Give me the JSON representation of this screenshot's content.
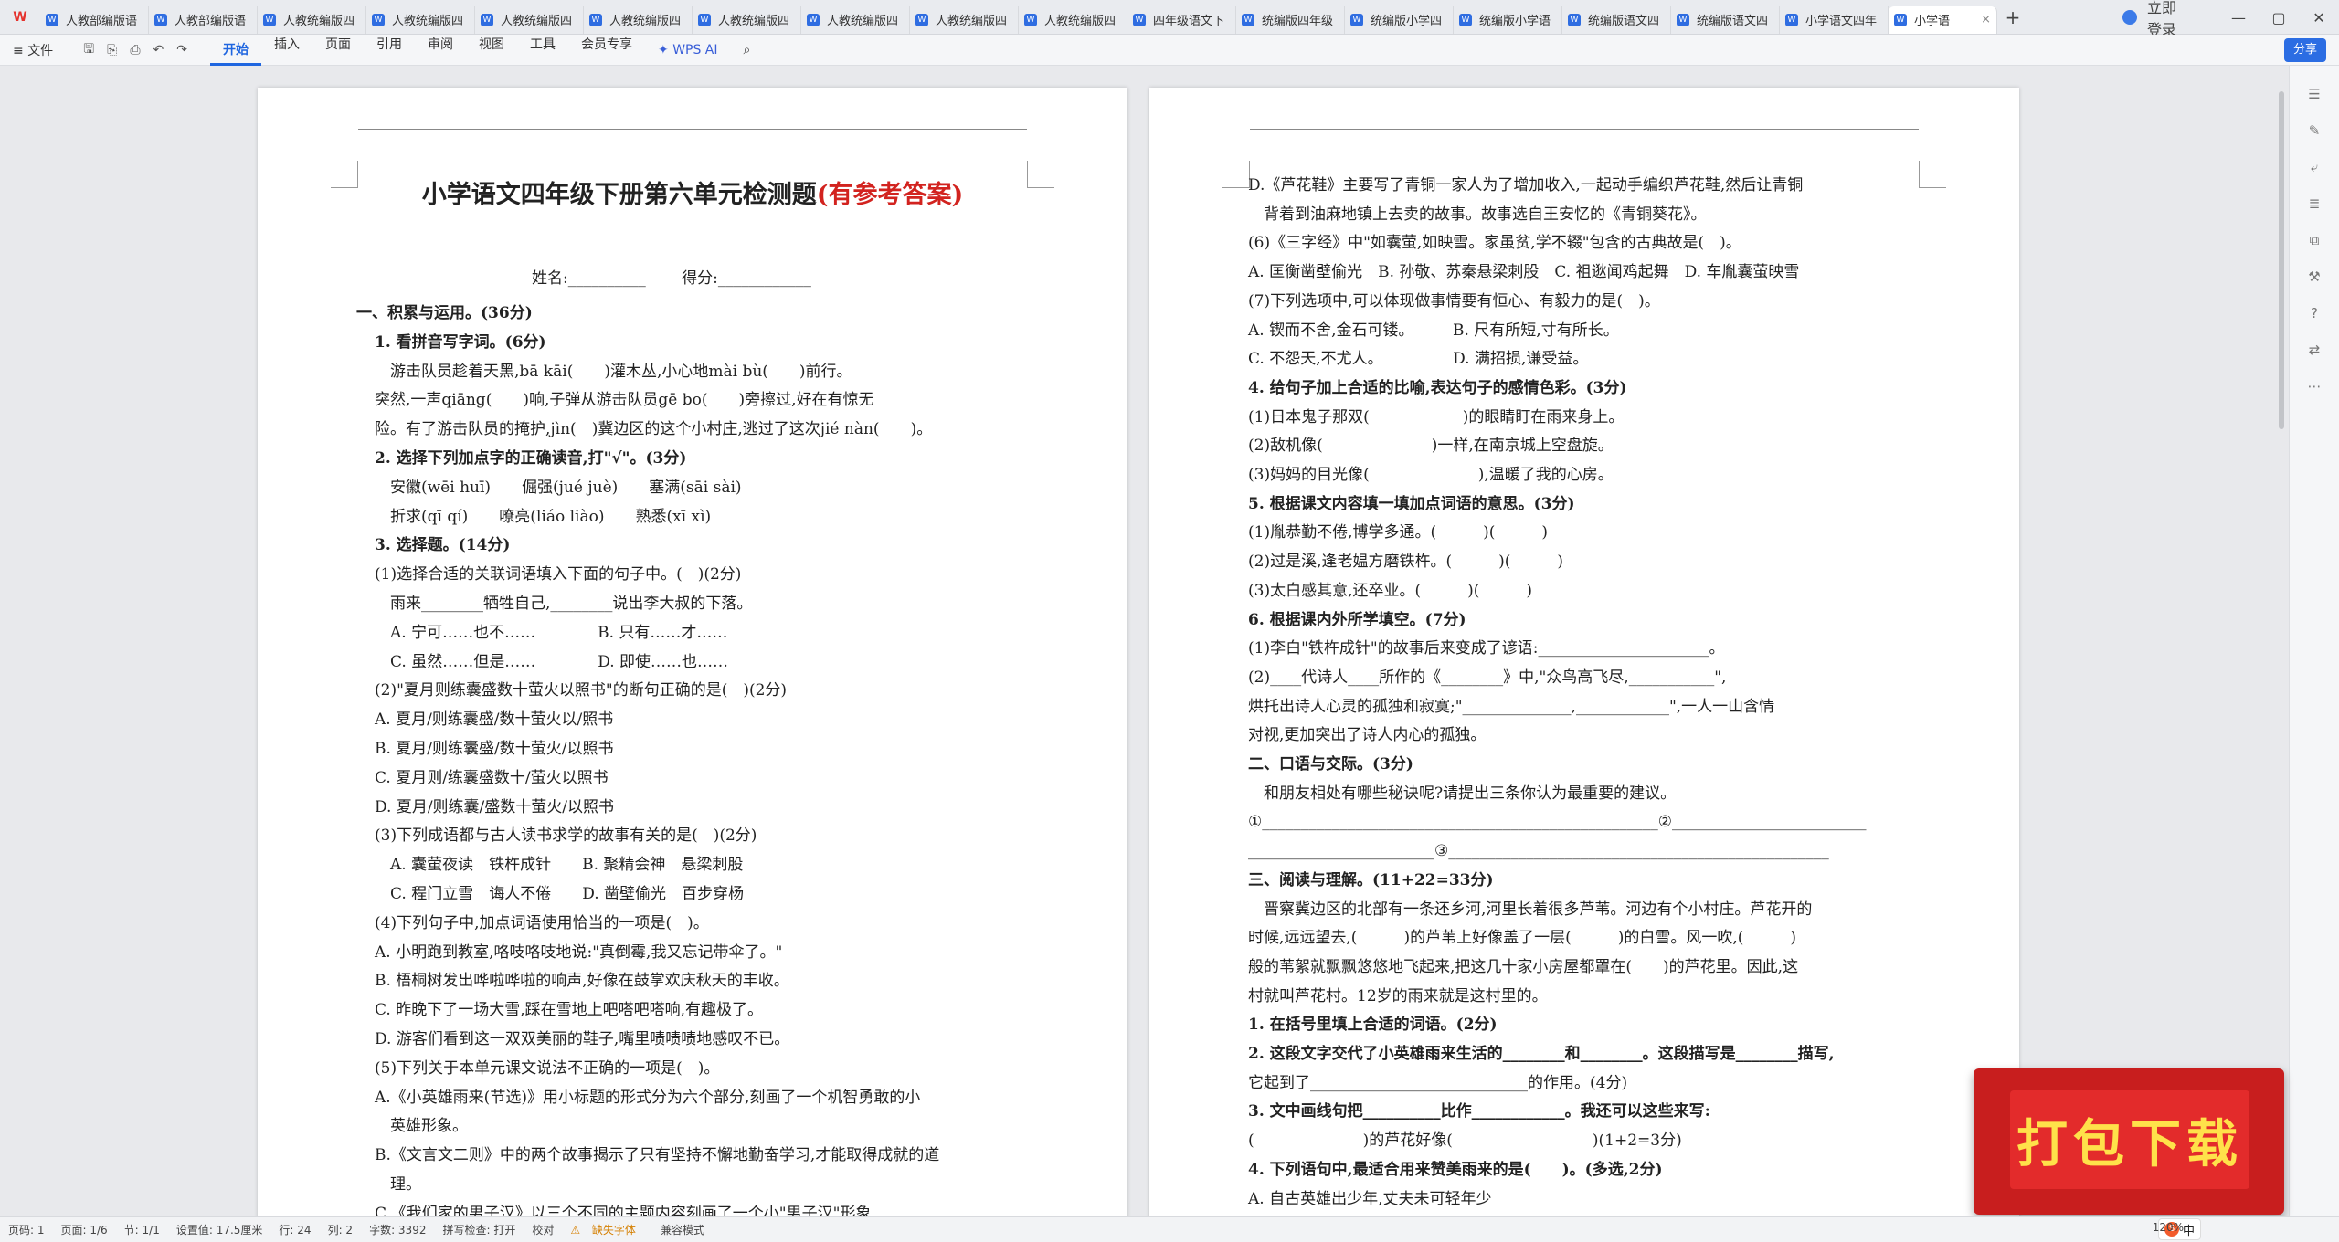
{
  "tabs": [
    "人教部编版语",
    "人教部编版语",
    "人教统编版四",
    "人教统编版四",
    "人教统编版四",
    "人教统编版四",
    "人教统编版四",
    "人教统编版四",
    "人教统编版四",
    "人教统编版四",
    "四年级语文下",
    "统编版四年级",
    "统编版小学四",
    "统编版小学语",
    "统编版语文四",
    "统编版语文四",
    "小学语文四年"
  ],
  "active_tab": "小学语",
  "login": "立即登录",
  "menu": {
    "file": "文件",
    "items": [
      "开始",
      "插入",
      "页面",
      "引用",
      "审阅",
      "视图",
      "工具",
      "会员专享"
    ],
    "wps_ai": "WPS AI"
  },
  "share": "分享",
  "page1": {
    "title": "小学语文四年级下册第六单元检测题",
    "title_red": "(有参考答案)",
    "lines": [
      "姓名:__________ 　　得分:____________",
      "一、积累与运用。(36分)",
      "1. 看拼音写字词。(6分)",
      "　游击队员趁着天黑,bā kāi(　　)灌木丛,小心地mài bù(　　)前行。",
      "突然,一声qiāng(　　)响,子弹从游击队员gē bo(　　)旁擦过,好在有惊无",
      "险。有了游击队员的掩护,jìn(　)冀边区的这个小村庄,逃过了这次jié nàn(　　)。",
      "2. 选择下列加点字的正确读音,打\"√\"。(3分)",
      "　安徽(wēi huī)　　倔强(jué juè)　　塞满(sāi sài)",
      "　折求(qī qí)　　嘹亮(liáo liào)　　熟悉(xī xì)",
      "3. 选择题。(14分)",
      "(1)选择合适的关联词语填入下面的句子中。(　)(2分)",
      "　雨来________牺牲自己,________说出李大叔的下落。",
      "　A. 宁可……也不……　　　　B. 只有……才……",
      "　C. 虽然……但是……　　　　D. 即使……也……",
      "(2)\"夏月则练囊盛数十萤火以照书\"的断句正确的是(　)(2分)",
      "A. 夏月/则练囊盛/数十萤火以/照书",
      "B. 夏月/则练囊盛/数十萤火/以照书",
      "C. 夏月则/练囊盛数十/萤火以照书",
      "D. 夏月/则练囊/盛数十萤火/以照书",
      "(3)下列成语都与古人读书求学的故事有关的是(　)(2分)",
      "　A. 囊萤夜读　铁杵成针　　B. 聚精会神　悬梁刺股",
      "　C. 程门立雪　诲人不倦　　D. 凿壁偷光　百步穿杨",
      "(4)下列句子中,加点词语使用恰当的一项是(　)。",
      "A. 小明跑到教室,咯吱咯吱地说:\"真倒霉,我又忘记带伞了。\"",
      "B. 梧桐树发出哗啦哗啦的响声,好像在鼓掌欢庆秋天的丰收。",
      "C. 昨晚下了一场大雪,踩在雪地上吧嗒吧嗒响,有趣极了。",
      "D. 游客们看到这一双双美丽的鞋子,嘴里啧啧啧地感叹不已。",
      "(5)下列关于本单元课文说法不正确的一项是(　)。",
      "A.《小英雄雨来(节选)》用小标题的形式分为六个部分,刻画了一个机智勇敢的小",
      "　英雄形象。",
      "B.《文言文二则》中的两个故事揭示了只有坚持不懈地勤奋学习,才能取得成就的道",
      "　理。",
      "C.《我们家的男子汉》以三个不同的主题内容刻画了一个小\"男子汉\"形象"
    ]
  },
  "page2": {
    "lines": [
      "D.《芦花鞋》主要写了青铜一家人为了增加收入,一起动手编织芦花鞋,然后让青铜",
      "　背着到油麻地镇上去卖的故事。故事选自王安忆的《青铜葵花》。",
      "(6)《三字经》中\"如囊萤,如映雪。家虽贫,学不辍\"包含的古典故是(　)。",
      "A. 匡衡凿壁偷光　B. 孙敬、苏秦悬梁刺股　C. 祖逖闻鸡起舞　D. 车胤囊萤映雪",
      "(7)下列选项中,可以体现做事情要有恒心、有毅力的是(　)。",
      "A. 锲而不舍,金石可镂。　　　B. 尺有所短,寸有所长。",
      "C. 不怨天,不尤人。　　　　　D. 满招损,谦受益。",
      "4. 给句子加上合适的比喻,表达句子的感情色彩。(3分)",
      "(1)日本鬼子那双(　　　　　　)的眼睛盯在雨来身上。",
      "(2)敌机像(　　　　　　　)一样,在南京城上空盘旋。",
      "(3)妈妈的目光像(　　　　　　　),温暖了我的心房。",
      "5. 根据课文内容填一填加点词语的意思。(3分)",
      "(1)胤恭勤不倦,博学多通。(　　　)(　　　)",
      "(2)过是溪,逢老媪方磨铁杵。(　　　)(　　　)",
      "(3)太白感其意,还卒业。(　　　)(　　　)",
      "6. 根据课内外所学填空。(7分)",
      "(1)李白\"铁杵成针\"的故事后来变成了谚语:______________________。",
      "(2)____代诗人____所作的《________》中,\"众鸟高飞尽,___________\",",
      "烘托出诗人心灵的孤独和寂寞;\"______________,____________\",一人一山含情",
      "对视,更加突出了诗人内心的孤独。",
      "二、口语与交际。(3分)",
      "　和朋友相处有哪些秘诀呢?请提出三条你认为最重要的建议。",
      "①___________________________________________________②_________________________",
      "________________________③_________________________________________________",
      "三、阅读与理解。(11+22=33分)",
      "　晋察冀边区的北部有一条还乡河,河里长着很多芦苇。河边有个小村庄。芦花开的",
      "时候,远远望去,(　　　)的芦苇上好像盖了一层(　　　)的白雪。风一吹,(　　　)",
      "般的苇絮就飘飘悠悠地飞起来,把这几十家小房屋都罩在(　　)的芦花里。因此,这",
      "村就叫芦花村。12岁的雨来就是这村里的。",
      "1. 在括号里填上合适的词语。(2分)",
      "2. 这段文字交代了小英雄雨来生活的________和________。这段描写是________描写,",
      "它起到了____________________________的作用。(4分)",
      "3. 文中画线句把__________比作____________。我还可以这些来写:",
      "(　　　　　　　)的芦花好像(　　　　　　　　　)(1+2=3分)",
      "4. 下列语句中,最适合用来赞美雨来的是(　　)。(多选,2分)",
      "A. 自古英雄出少年,丈夫未可轻年少"
    ]
  },
  "status": {
    "page": "页码: 1",
    "pages": "页面: 1/6",
    "section": "节: 1/1",
    "setting": "设置值: 17.5厘米",
    "row": "行: 24",
    "col": "列: 2",
    "words": "字数: 3392",
    "spell": "拼写检查: 打开",
    "proof": "校对",
    "font": "缺失字体",
    "compat": "兼容模式",
    "zoom": "120%"
  },
  "ime": "中",
  "promo": "打包下载"
}
